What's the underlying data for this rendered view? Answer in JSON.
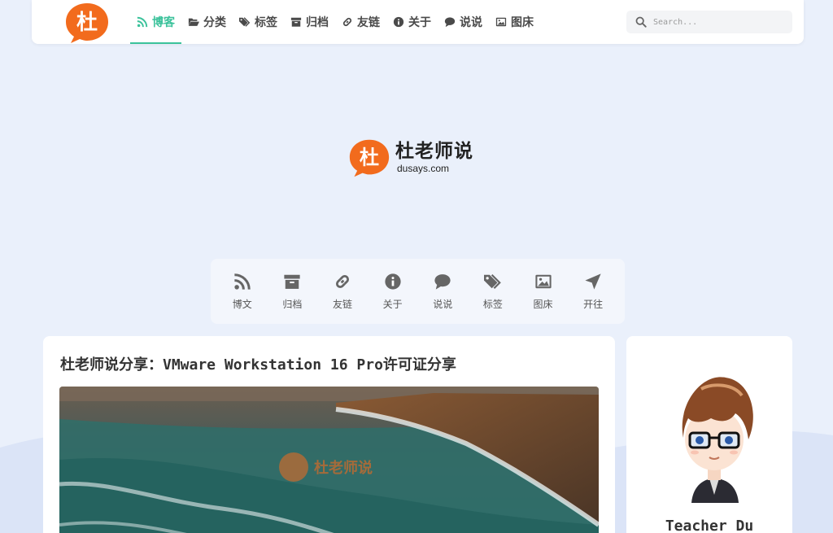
{
  "nav": {
    "logo_text": "杜",
    "items": [
      {
        "label": "博客",
        "icon": "rss-icon",
        "active": true
      },
      {
        "label": "分类",
        "icon": "folder-open-icon",
        "active": false
      },
      {
        "label": "标签",
        "icon": "tags-icon",
        "active": false
      },
      {
        "label": "归档",
        "icon": "archive-icon",
        "active": false
      },
      {
        "label": "友链",
        "icon": "link-icon",
        "active": false
      },
      {
        "label": "关于",
        "icon": "info-circle-icon",
        "active": false
      },
      {
        "label": "说说",
        "icon": "comment-icon",
        "active": false
      },
      {
        "label": "图床",
        "icon": "image-icon",
        "active": false
      }
    ],
    "search_placeholder": "Search..."
  },
  "hero": {
    "logo_char": "杜",
    "title": "杜老师说",
    "subtitle": "dusays.com"
  },
  "quick_links": [
    {
      "label": "博文",
      "icon": "rss-icon"
    },
    {
      "label": "归档",
      "icon": "archive-icon"
    },
    {
      "label": "友链",
      "icon": "link-icon"
    },
    {
      "label": "关于",
      "icon": "info-circle-icon"
    },
    {
      "label": "说说",
      "icon": "comment-icon"
    },
    {
      "label": "标签",
      "icon": "tags-icon"
    },
    {
      "label": "图床",
      "icon": "image-icon"
    },
    {
      "label": "开往",
      "icon": "paper-plane-icon"
    }
  ],
  "post": {
    "title": "杜老师说分享：VMware Workstation 16 Pro许可证分享",
    "watermark": "杜老师说"
  },
  "profile": {
    "name": "Teacher Du"
  },
  "colors": {
    "accent": "#3bc29b",
    "brand_orange": "#f26b1d",
    "background": "#eaf0fb"
  }
}
